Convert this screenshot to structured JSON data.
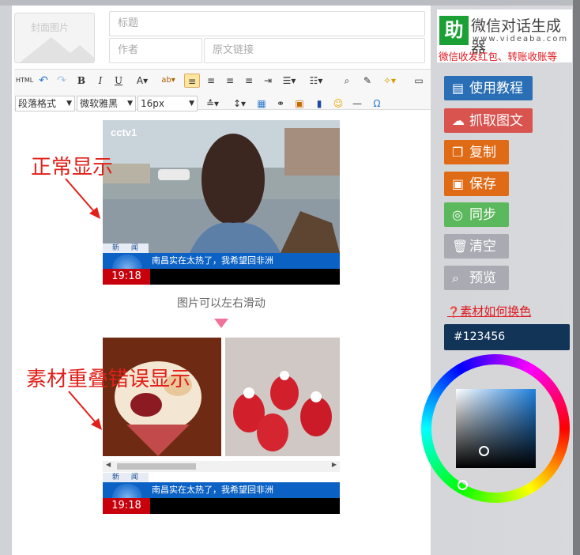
{
  "header": {
    "cover_label": "封面图片",
    "title_placeholder": "标题",
    "author_placeholder": "作者",
    "source_link_placeholder": "原文链接"
  },
  "toolbar": {
    "row1": [
      "HTML",
      "↶",
      "↷",
      "B",
      "I",
      "U",
      "A▾",
      "ab▾",
      "≡",
      "≡",
      "≡",
      "≡",
      "⇥",
      "☰▾",
      "☷▾",
      "⌕",
      "✎",
      "✧▾",
      "▭"
    ],
    "paragraph_format": "段落格式",
    "font_family": "微软雅黑",
    "font_size": "16px"
  },
  "content": {
    "annotation_normal": "正常显示",
    "annotation_overlap": "素材重叠错误显示",
    "swipe_hint": "图片可以左右滑动",
    "news_tag": "新 闻",
    "news_caption": "南昌实在太热了，我希望回非洲",
    "news_time": "19:18",
    "channel_logo": "cctv1"
  },
  "sidebar": {
    "brand_name": "微信对话生成器",
    "brand_url": "www.videaba.com",
    "brand_logo": "助",
    "brand_promo": "微信收发红包、转账收账等",
    "buttons": [
      {
        "label": "使用教程",
        "icon": "book-icon",
        "color": "#2a6fb6"
      },
      {
        "label": "抓取图文",
        "icon": "cloud-download-icon",
        "color": "#d9534f"
      },
      {
        "label": "复制",
        "icon": "copy-icon",
        "color": "#e06b16"
      },
      {
        "label": "保存",
        "icon": "save-icon",
        "color": "#e06b16"
      },
      {
        "label": "同步",
        "icon": "wechat-icon",
        "color": "#5cb85c"
      },
      {
        "label": "清空",
        "icon": "trash-icon",
        "color": "#a9aab2"
      },
      {
        "label": "预览",
        "icon": "search-icon",
        "color": "#a9aab2"
      }
    ],
    "help_link": "素材如何换色",
    "color_value": "#123456"
  }
}
